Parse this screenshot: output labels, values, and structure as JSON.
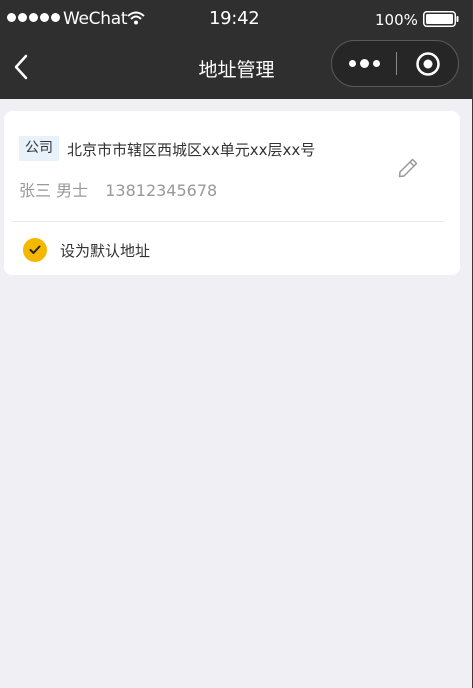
{
  "status_bar": {
    "carrier": "WeChat",
    "time": "19:42",
    "battery_percent": "100%",
    "battery_level": 1.0,
    "signal_icon": "signal-dots-icon",
    "wifi_icon": "wifi-icon",
    "battery_icon": "battery-icon"
  },
  "nav": {
    "title": "地址管理",
    "back_icon": "chevron-left-icon",
    "more_icon": "more-dots-icon",
    "close_icon": "target-close-icon"
  },
  "address_card": {
    "tag": "公司",
    "address": "北京市市辖区西城区xx单元xx层xx号",
    "name": "张三",
    "gender": "男士",
    "phone": "13812345678",
    "edit_icon": "pencil-icon",
    "default_label": "设为默认地址",
    "is_default": true,
    "check_icon": "check-icon"
  },
  "colors": {
    "nav_background": "#2f2f2f",
    "page_background": "#efeff4",
    "accent": "#f5b800",
    "tag_background": "#e7f2fb",
    "muted_text": "#999999"
  }
}
